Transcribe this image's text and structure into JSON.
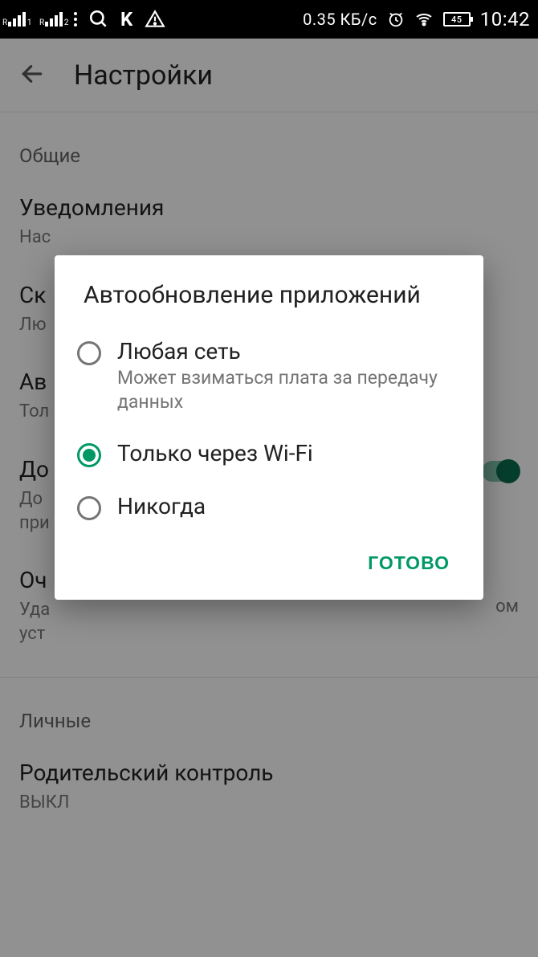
{
  "status_bar": {
    "net_speed": "0.35 КБ/с",
    "battery_pct": "45",
    "clock": "10:42"
  },
  "app_bar": {
    "title": "Настройки"
  },
  "sections": {
    "general": {
      "header": "Общие",
      "notifications": {
        "title": "Уведомления",
        "sub": "Нас"
      },
      "download": {
        "title": "Ск",
        "sub": "Лю"
      },
      "autoupdate": {
        "title": "Ав",
        "sub": "Тол"
      },
      "access": {
        "title": "До",
        "sub_l1": "До",
        "sub_l2": "при"
      },
      "clear": {
        "title": "Оч",
        "sub_l1": "Уда",
        "sub_l2": "уст",
        "sub_r": "ом"
      }
    },
    "personal": {
      "header": "Личные",
      "parental": {
        "title": "Родительский контроль",
        "sub": "ВЫКЛ"
      }
    }
  },
  "dialog": {
    "title": "Автообновление приложений",
    "options": [
      {
        "label": "Любая сеть",
        "sub": "Может взиматься плата за передачу данных",
        "checked": false
      },
      {
        "label": "Только через Wi-Fi",
        "sub": "",
        "checked": true
      },
      {
        "label": "Никогда",
        "sub": "",
        "checked": false
      }
    ],
    "done": "ГОТОВО"
  }
}
